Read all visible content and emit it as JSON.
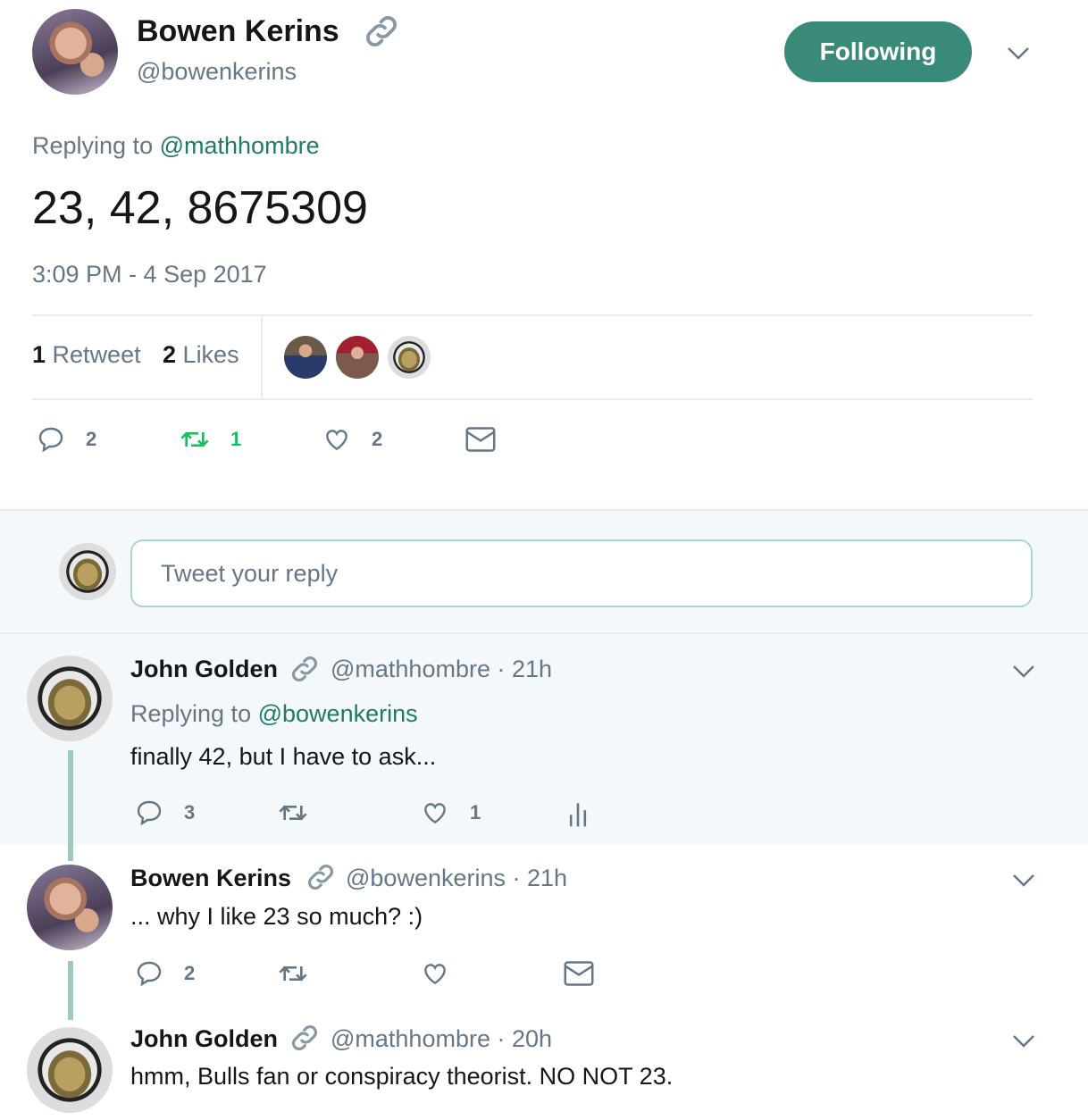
{
  "tweet": {
    "author_name": "Bowen Kerins",
    "author_handle": "@bowenkerins",
    "follow_label": "Following",
    "replying_prefix": "Replying to",
    "replying_mention": "@mathhombre",
    "text": "23, 42, 8675309",
    "timestamp": "3:09 PM - 4 Sep 2017",
    "retweet_count": "1",
    "retweet_label": "Retweet",
    "likes_count": "2",
    "likes_label": "Likes",
    "actions": {
      "reply": "2",
      "retweet": "1",
      "like": "2"
    }
  },
  "compose": {
    "placeholder": "Tweet your reply"
  },
  "replies": [
    {
      "name": "John Golden",
      "handle_time": "@mathhombre · 21h",
      "replying_prefix": "Replying to",
      "replying_mention": "@bowenkerins",
      "text": "finally 42, but I have to ask...",
      "actions": {
        "reply": "3",
        "like": "1"
      }
    },
    {
      "name": "Bowen Kerins",
      "handle_time": "@bowenkerins · 21h",
      "text": "... why I like 23 so much? :)",
      "actions": {
        "reply": "2"
      }
    },
    {
      "name": "John Golden",
      "handle_time": "@mathhombre · 20h",
      "text": "hmm, Bulls fan or conspiracy theorist. NO NOT 23."
    }
  ],
  "colors": {
    "accent": "#3a8a7a",
    "mention": "#1f7a6a",
    "retweet_active": "#17bf63",
    "muted": "#657786"
  },
  "icons": [
    "link-icon",
    "chevron-down-icon",
    "reply-icon",
    "retweet-icon",
    "like-icon",
    "message-icon",
    "analytics-icon"
  ]
}
